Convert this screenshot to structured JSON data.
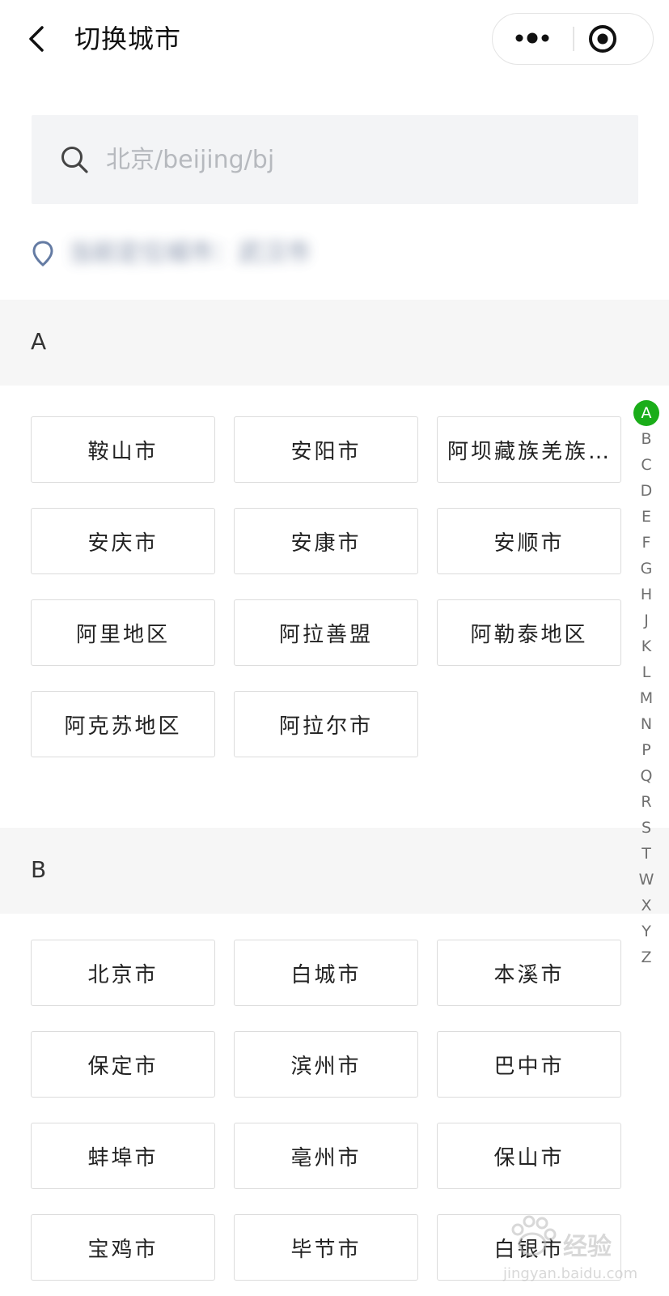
{
  "nav": {
    "title": "切换城市"
  },
  "search": {
    "placeholder": "北京/beijing/bj"
  },
  "location": {
    "text": "当前定位城市：武汉市"
  },
  "sections": [
    {
      "letter": "A",
      "cities": [
        "鞍山市",
        "安阳市",
        "阿坝藏族羌族…",
        "安庆市",
        "安康市",
        "安顺市",
        "阿里地区",
        "阿拉善盟",
        "阿勒泰地区",
        "阿克苏地区",
        "阿拉尔市"
      ]
    },
    {
      "letter": "B",
      "cities": [
        "北京市",
        "白城市",
        "本溪市",
        "保定市",
        "滨州市",
        "巴中市",
        "蚌埠市",
        "亳州市",
        "保山市",
        "宝鸡市",
        "毕节市",
        "白银市"
      ]
    }
  ],
  "index_bar": {
    "letters": [
      "A",
      "B",
      "C",
      "D",
      "E",
      "F",
      "G",
      "H",
      "J",
      "K",
      "L",
      "M",
      "N",
      "P",
      "Q",
      "R",
      "S",
      "T",
      "W",
      "X",
      "Y",
      "Z"
    ],
    "active": "A",
    "active_color": "#1aad19"
  },
  "watermark": {
    "text": "经验",
    "sub": "jingyan.baidu.com"
  }
}
